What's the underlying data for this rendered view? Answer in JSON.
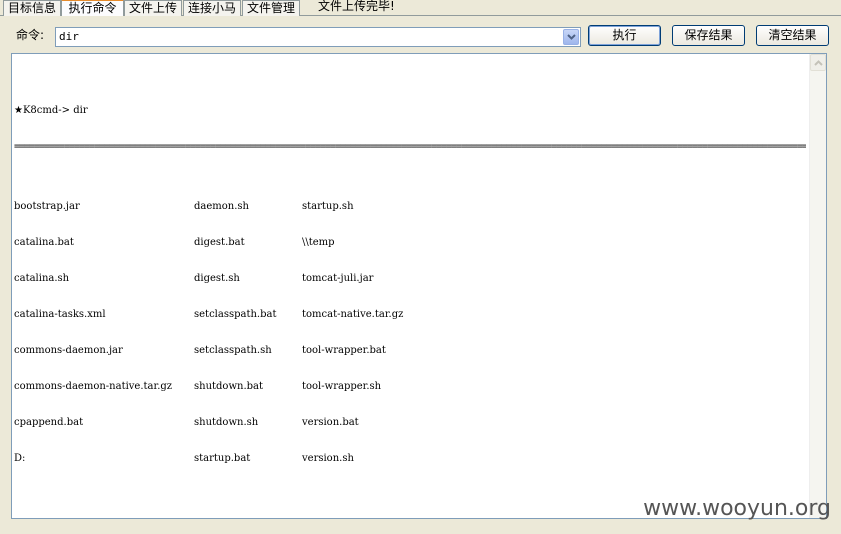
{
  "tabs": [
    {
      "label": "目标信息",
      "active": false
    },
    {
      "label": "执行命令",
      "active": true
    },
    {
      "label": "文件上传",
      "active": false
    },
    {
      "label": "连接小马",
      "active": false
    },
    {
      "label": "文件管理",
      "active": false
    }
  ],
  "status_message": "文件上传完毕!",
  "command": {
    "label": "命令:",
    "value": "dir"
  },
  "buttons": {
    "execute": "执行",
    "save": "保存结果",
    "clear": "清空结果"
  },
  "output": {
    "prompt_line": "★K8cmd-> dir",
    "separator": "====================================================================================================================================================================",
    "columns": [
      [
        "bootstrap.jar",
        "catalina.bat",
        "catalina.sh",
        "catalina-tasks.xml",
        "commons-daemon.jar",
        "commons-daemon-native.tar.gz",
        "cpappend.bat",
        "D:"
      ],
      [
        "daemon.sh",
        "digest.bat",
        "digest.sh",
        "setclasspath.bat",
        "setclasspath.sh",
        "shutdown.bat",
        "shutdown.sh",
        "startup.bat"
      ],
      [
        "startup.sh",
        "\\\\temp",
        "tomcat-juli.jar",
        "tomcat-native.tar.gz",
        "tool-wrapper.bat",
        "tool-wrapper.sh",
        "version.bat",
        "version.sh"
      ]
    ]
  },
  "watermark": "www.wooyun.org"
}
